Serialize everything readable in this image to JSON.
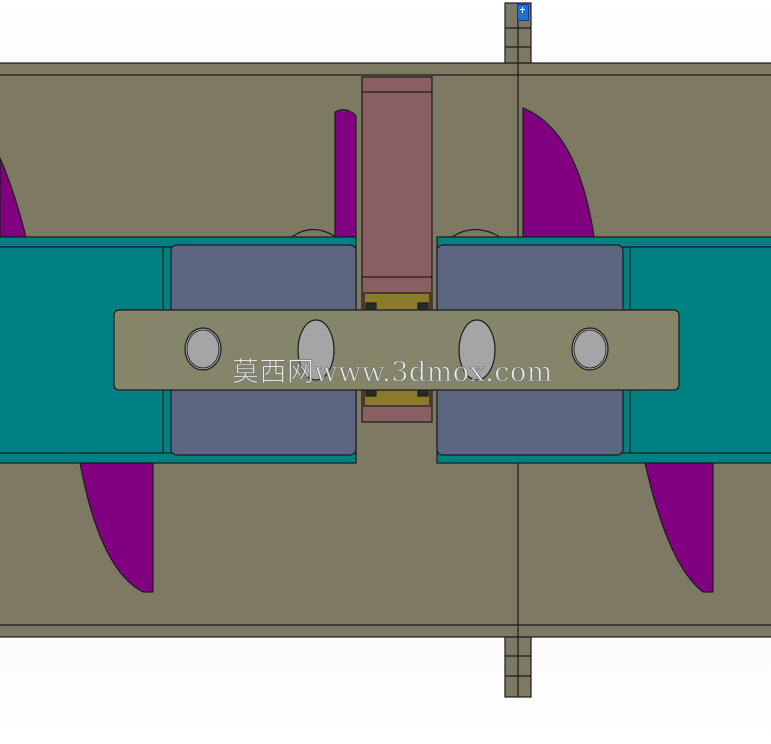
{
  "watermark": {
    "text": "莫西网www.3dmox.com"
  },
  "colors": {
    "housing": "#7d7962",
    "blade": "#800080",
    "shaft": "#008080",
    "hub": "#5d6681",
    "plate": "#85856a",
    "bolt": "#a5a5a5",
    "bearing_block": "#8a5f62",
    "bearing": "#8a7a2c",
    "line": "#1c1c1c"
  },
  "icons": {
    "axis_indicator": "axis-triad-icon"
  }
}
